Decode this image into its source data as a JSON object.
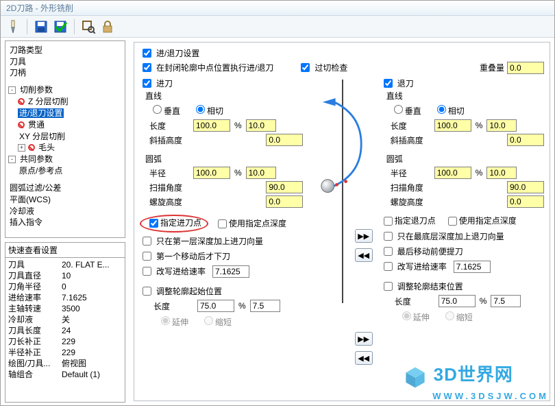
{
  "window": {
    "title": "2D刀路 - 外形铣削"
  },
  "toolbar": {
    "tool": "tool-icon",
    "save": "save-icon",
    "save2": "save-green-icon",
    "zoom": "zoom-extents-icon",
    "lock": "lock-icon"
  },
  "tree": {
    "n0": "刀路类型",
    "n1": "刀具",
    "n2": "刀柄",
    "n3": "切削参数",
    "n3a": "Z 分层切削",
    "n3b": "进/退刀设置",
    "n3c": "贯通",
    "n3d": "XY 分层切削",
    "n3e": "毛头",
    "n4": "共同参数",
    "n4a": "原点/参考点",
    "n5": "圆弧过滤/公差",
    "n6": "平面(WCS)",
    "n7": "冷却液",
    "n8": "插入指令"
  },
  "quickview": {
    "header": "快速查看设置",
    "rows": [
      {
        "k": "刀具",
        "v": "20. FLAT E..."
      },
      {
        "k": "刀具直径",
        "v": "10"
      },
      {
        "k": "刀角半径",
        "v": "0"
      },
      {
        "k": "进给速率",
        "v": "7.1625"
      },
      {
        "k": "主轴转速",
        "v": "3500"
      },
      {
        "k": "冷却液",
        "v": "关"
      },
      {
        "k": "刀具长度",
        "v": "24"
      },
      {
        "k": "刀长补正",
        "v": "229"
      },
      {
        "k": "半径补正",
        "v": "229"
      },
      {
        "k": "绘图/刀具...",
        "v": "俯视图"
      },
      {
        "k": "轴组合",
        "v": "Default (1)"
      }
    ]
  },
  "labels": {
    "lead_settings": "进/退刀设置",
    "closed_midpoint": "在封闭轮廓中点位置执行进/退刀",
    "gouge_check": "过切检查",
    "overlap": "重叠量",
    "entry": "进刀",
    "exit": "退刀",
    "line": "直线",
    "perp": "垂直",
    "tangent": "相切",
    "length": "长度",
    "ramp_h": "斜插高度",
    "arc": "圆弧",
    "radius": "半径",
    "sweep": "扫描角度",
    "helix_h": "螺旋高度",
    "spec_entry_pt": "指定进刀点",
    "use_pt_depth": "使用指定点深度",
    "only_first_layer": "只在第一层深度加上进刀向量",
    "first_move_plunge": "第一个移动后才下刀",
    "override_feed_in": "改写进给速率",
    "spec_exit_pt": "指定退刀点",
    "only_last_layer": "只在最底层深度加上退刀向量",
    "last_move_retract": "最后移动前便提刀",
    "override_feed_out": "改写进给速率",
    "adjust_start": "调整轮廓起始位置",
    "adjust_end": "调整轮廓结束位置",
    "extend": "延伸",
    "shorten": "缩短"
  },
  "vals": {
    "overlap": "0.0",
    "entry": {
      "len_pct": "100.0",
      "len": "10.0",
      "ramp_h": "0.0",
      "rad_pct": "100.0",
      "rad": "10.0",
      "sweep": "90.0",
      "helix_h": "0.0",
      "feed": "7.1625"
    },
    "exit": {
      "len_pct": "100.0",
      "len": "10.0",
      "ramp_h": "0.0",
      "rad_pct": "100.0",
      "rad": "10.0",
      "sweep": "90.0",
      "helix_h": "0.0",
      "feed": "7.1625"
    },
    "adjust": {
      "len_pct": "75.0",
      "len": "7.5"
    }
  },
  "watermark": {
    "cn": "3D世界网",
    "en": "WWW.3DSJW.COM"
  }
}
